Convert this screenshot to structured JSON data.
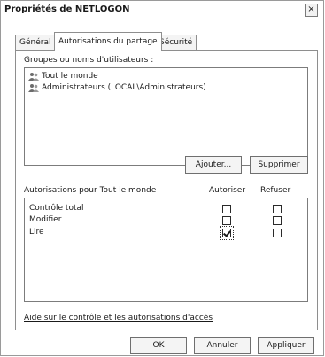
{
  "window": {
    "title": "Propriétés de NETLOGON",
    "close_glyph": "×"
  },
  "tabs": [
    {
      "label": "Général",
      "active": false
    },
    {
      "label": "Autorisations du partage",
      "active": true
    },
    {
      "label": "Sécurité",
      "active": false
    }
  ],
  "groups": {
    "label": "Groupes ou noms d'utilisateurs :",
    "items": [
      {
        "name": "Tout le monde",
        "selected": true,
        "icon": "users-icon"
      },
      {
        "name": "Administrateurs (LOCAL\\Administrateurs)",
        "selected": false,
        "icon": "users-icon"
      }
    ]
  },
  "buttons": {
    "add": "Ajouter...",
    "remove": "Supprimer"
  },
  "permissions": {
    "label": "Autorisations pour Tout le monde",
    "allow_header": "Autoriser",
    "deny_header": "Refuser",
    "rows": [
      {
        "name": "Contrôle total",
        "allow": false,
        "deny": false
      },
      {
        "name": "Modifier",
        "allow": false,
        "deny": false
      },
      {
        "name": "Lire",
        "allow": true,
        "deny": false
      }
    ]
  },
  "help_link": "Aide sur le contrôle et les autorisations d'accès",
  "footer": {
    "ok": "OK",
    "cancel": "Annuler",
    "apply": "Appliquer"
  }
}
